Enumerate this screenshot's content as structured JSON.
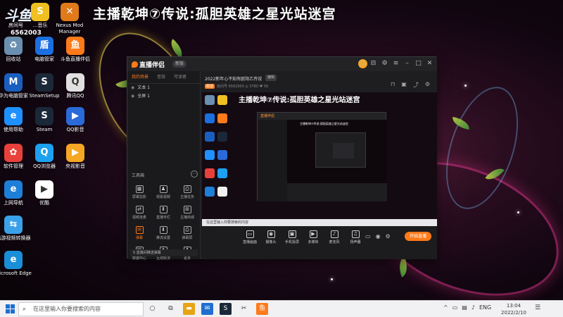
{
  "stream_title": "主播乾坤⑦传说:孤胆英雄之星光站迷宫",
  "logo": {
    "glyph": "斗鱼",
    "line1": "房间号",
    "room_number": "6562003"
  },
  "desktop_icons": [
    {
      "label": "回收站",
      "glyph": "♻",
      "color": "#6b8fb0"
    },
    {
      "label": "电脑管家",
      "glyph": "盾",
      "color": "#1b6fe0"
    },
    {
      "label": "斗鱼直播伴侣",
      "glyph": "鱼",
      "color": "#ff7a1a"
    },
    {
      "label": "华为电脑管家",
      "glyph": "M",
      "color": "#1a5fbf"
    },
    {
      "label": "SteamSetup",
      "glyph": "S",
      "color": "#1b2838"
    },
    {
      "label": "腾讯QQ",
      "glyph": "Q",
      "color": "#e0e0e0"
    },
    {
      "label": "使用帮助",
      "glyph": "e",
      "color": "#1e90ff"
    },
    {
      "label": "Steam",
      "glyph": "S",
      "color": "#1b2838"
    },
    {
      "label": "QQ影音",
      "glyph": "▶",
      "color": "#2a6ad9"
    },
    {
      "label": "软件管理",
      "glyph": "✿",
      "color": "#e8413c"
    },
    {
      "label": "QQ浏览器",
      "glyph": "Q",
      "color": "#1ea0f0"
    },
    {
      "label": "央视影音",
      "glyph": "▶",
      "color": "#f5a623"
    },
    {
      "label": "上网导航",
      "glyph": "e",
      "color": "#1e7fd8"
    },
    {
      "label": "优酷",
      "glyph": "▶",
      "color": "#ffffff"
    },
    {
      "label": "迅游视频转换器",
      "glyph": "⇆",
      "color": "#3aa0e8"
    },
    {
      "label": "Microsoft Edge",
      "glyph": "e",
      "color": "#1a8fd8"
    }
  ],
  "top_icons": [
    {
      "label": "…音乐",
      "glyph": "S",
      "color": "#f0c020"
    },
    {
      "label": "Nexus Mod Manager",
      "glyph": "✕",
      "color": "#e07a1a"
    }
  ],
  "app": {
    "name": "直播伴侣",
    "version": "新版",
    "left_tabs": [
      "我的场景",
      "音效",
      "可读者"
    ],
    "sources": [
      {
        "label": "文本 1"
      },
      {
        "label": "全屏 1"
      }
    ],
    "tools_title": "工具箱",
    "tools": [
      {
        "label": "屏幕剪影",
        "glyph": "▦"
      },
      {
        "label": "观看视频",
        "glyph": "♟"
      },
      {
        "label": "主播任务",
        "glyph": "⎙"
      },
      {
        "label": "视频连麦",
        "glyph": "⇄"
      },
      {
        "label": "直播专栏",
        "glyph": "⬇"
      },
      {
        "label": "主播商城",
        "glyph": "⊞"
      },
      {
        "label": "弹幕",
        "glyph": "✉"
      },
      {
        "label": "推流设置",
        "glyph": "⬇"
      },
      {
        "label": "弹幕屏",
        "glyph": "⎙"
      },
      {
        "label": "数据中心",
        "glyph": "▤"
      },
      {
        "label": "互动玩法",
        "glyph": "♦"
      },
      {
        "label": "更多",
        "glyph": "⬇"
      }
    ],
    "footer": "S 直播间推送弹幕",
    "room_title": "2022新年心不知有欧阳乙传说",
    "edit": "编辑",
    "tag": "频道",
    "meta": "房间号 6562003",
    "viewers": "3780",
    "followers": "56",
    "preview_title": "主播乾坤⑦传说:孤胆英雄之星光站迷宫",
    "nested_label": "直播伴侣",
    "nested_title": "主播乾坤⑦传说:孤胆英雄之星光站迷宫",
    "preview_taskbar": "在这里输入你要搜索的内容",
    "bottom_items": [
      {
        "label": "直播画面",
        "glyph": "▭"
      },
      {
        "label": "摄像头",
        "glyph": "◉"
      },
      {
        "label": "手机投屏",
        "glyph": "▣"
      },
      {
        "label": "多媒体",
        "glyph": "▶"
      },
      {
        "label": "麦克风",
        "glyph": "♪"
      },
      {
        "label": "扬声器",
        "glyph": "♫"
      }
    ],
    "start_button": "开始直播"
  },
  "taskbar": {
    "search_placeholder": "在这里输入你要搜索的内容",
    "time": "13:04",
    "date": "2022/2/10",
    "ime": "ENG"
  }
}
